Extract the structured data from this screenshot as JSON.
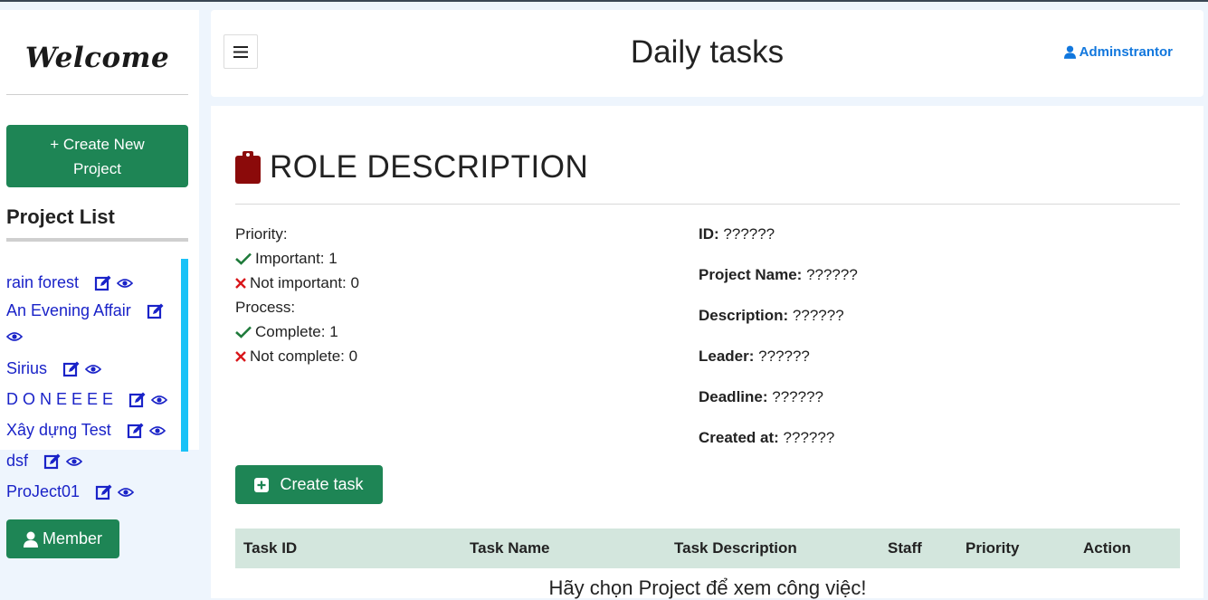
{
  "sidebar": {
    "welcome": "Welcome",
    "create_project_line1": "+ Create New",
    "create_project_line2": "Project",
    "project_list_title": "Project List",
    "projects": [
      {
        "name": "rain forest"
      },
      {
        "name": "An Evening Affair"
      },
      {
        "name": "Sirius"
      },
      {
        "name": "D O N E E E E"
      },
      {
        "name": "Xây dựng Test"
      },
      {
        "name": "dsf"
      },
      {
        "name": "ProJect01"
      }
    ],
    "member_button": "Member"
  },
  "header": {
    "title": "Daily tasks",
    "user": "Adminstrantor"
  },
  "role": {
    "title": "ROLE DESCRIPTION",
    "priority_label": "Priority:",
    "important": "Important: 1",
    "not_important": "Not important: 0",
    "process_label": "Process:",
    "complete": "Complete: 1",
    "not_complete": "Not complete: 0"
  },
  "details": {
    "id_label": "ID:",
    "id_value": "??????",
    "project_name_label": "Project Name:",
    "project_name_value": "??????",
    "description_label": "Description:",
    "description_value": "??????",
    "leader_label": "Leader:",
    "leader_value": "??????",
    "deadline_label": "Deadline:",
    "deadline_value": "??????",
    "created_label": "Created at:",
    "created_value": "??????"
  },
  "create_task_button": "Create task",
  "table": {
    "columns": [
      "Task ID",
      "Task Name",
      "Task Description",
      "Staff",
      "Priority",
      "Action"
    ],
    "empty_message": "Hãy chọn Project để xem công việc!"
  },
  "colors": {
    "accent_green": "#1e8555",
    "link_blue": "#1a23c8",
    "admin_blue": "#1177dd",
    "scroll_cyan": "#1ac2f7",
    "clipboard_red": "#8b0a0a",
    "table_header_bg": "#d3e6dd"
  }
}
